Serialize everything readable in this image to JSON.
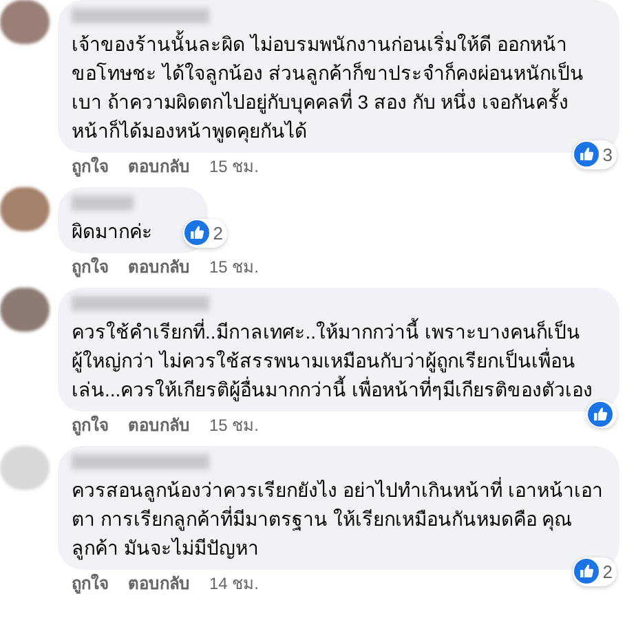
{
  "comments": [
    {
      "text": "เจ้าของร้านนั้นละผิด ไม่อบรมพนักงานก่อนเริ่มให้ดี ออกหน้าขอโทษชะ ได้ใจลูกน้อง ส่วนลูกค้าก็ขาประจำก็คงผ่อนหนักเป็นเบา ถ้าความผิดตกไปอยู่กับบุคคลที่ 3 สอง กับ หนึ่ง เจอกันครั้งหน้าก็ได้มองหน้าพูดคุยกันได้",
      "like_count": "3",
      "actions": {
        "like": "ถูกใจ",
        "reply": "ตอบกลับ",
        "time": "15 ชม."
      }
    },
    {
      "text": "ผิดมากค่ะ",
      "like_count": "2",
      "actions": {
        "like": "ถูกใจ",
        "reply": "ตอบกลับ",
        "time": "15 ชม."
      }
    },
    {
      "text": "ควรใช้คำเรียกที่..มีกาลเทศะ..ให้มากกว่านี้ เพราะบางคนก็เป็นผู้ใหญ่กว่า ไม่ควรใช้สรรพนามเหมือนกับว่าผู้ถูกเรียกเป็นเพื่อนเล่น...ควรให้เกียรติผู้อื่นมากกว่านี้ เพื่อหน้าที่ๆมีเกียรติของตัวเอง",
      "liked": true,
      "actions": {
        "like": "ถูกใจ",
        "reply": "ตอบกลับ",
        "time": "15 ชม."
      }
    },
    {
      "text": "ควรสอนลูกน้องว่าควรเรียกยังไง อย่าไปทำเกินหน้าที่ เอาหน้าเอาตา การเรียกลูกค้าที่มีมาตรฐาน ให้เรียกเหมือนกันหมดคือ คุณลูกค้า มันจะไม่มีปัญหา",
      "like_count": "2",
      "actions": {
        "like": "ถูกใจ",
        "reply": "ตอบกลับ",
        "time": "14 ชม."
      }
    }
  ]
}
